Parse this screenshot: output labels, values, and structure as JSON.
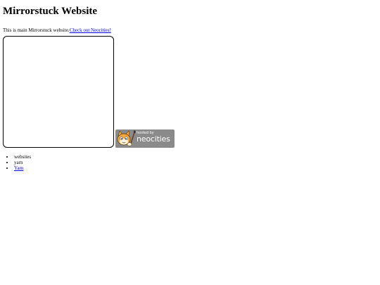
{
  "header": {
    "title": "Mirrorstuck Website"
  },
  "intro": {
    "text": "This is main Mirrorstuck website.",
    "link_label": "Check out Neocities!"
  },
  "badge": {
    "small_text": "hosted by",
    "brand_text": "neocities",
    "colors": {
      "background": "#8a8a8a",
      "cat_fur": "#f4a640",
      "text": "#ffffff"
    }
  },
  "list": {
    "items": [
      {
        "label": "websites",
        "is_link": false
      },
      {
        "label": "yarn",
        "is_link": false
      },
      {
        "label": "Yarn",
        "is_link": true
      }
    ]
  }
}
